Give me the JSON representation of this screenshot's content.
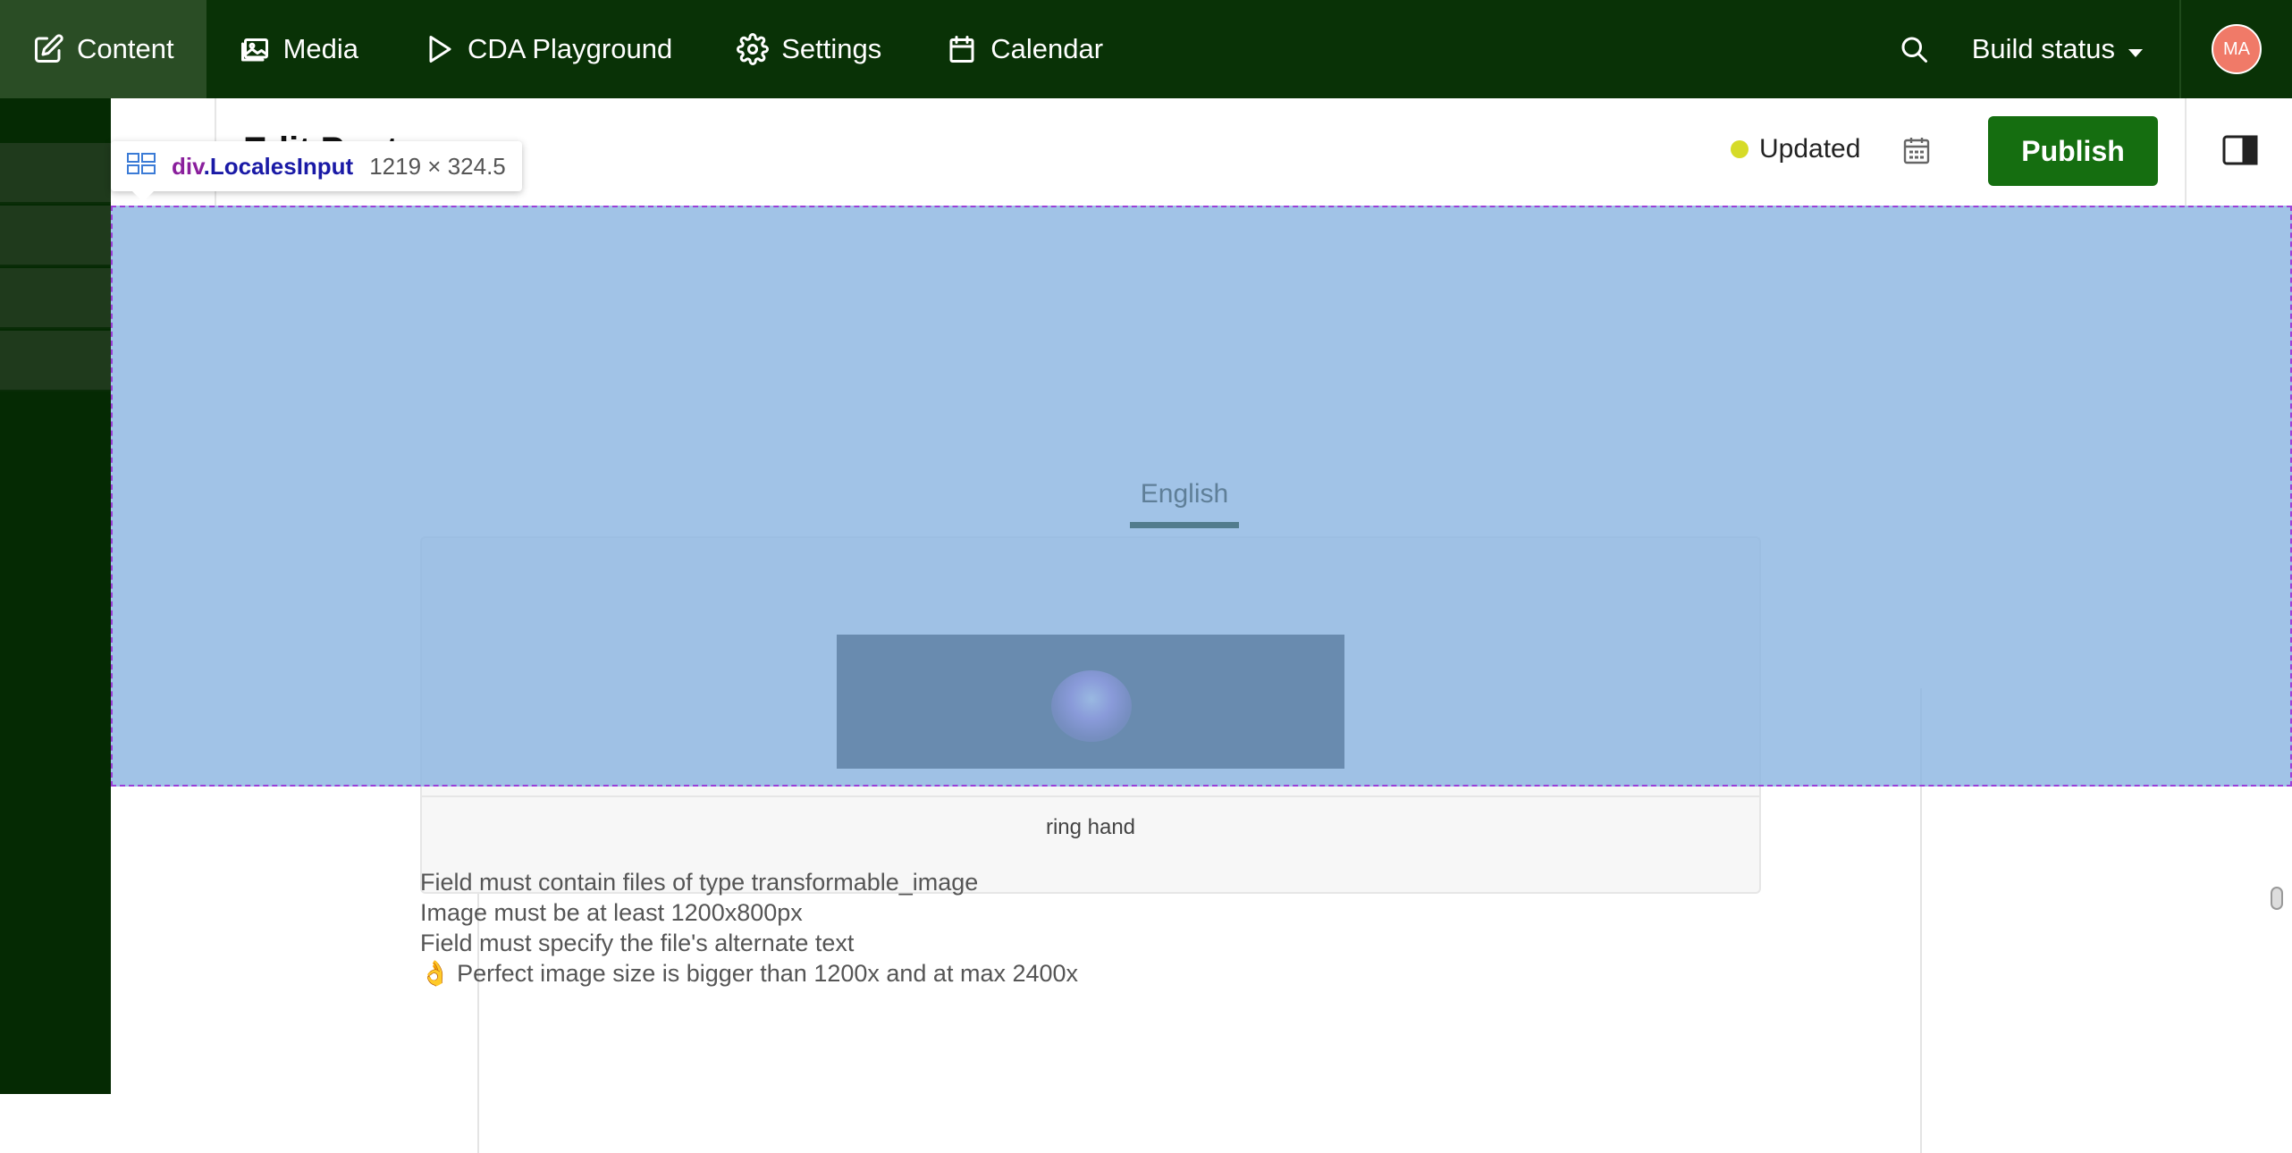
{
  "nav": {
    "items": [
      {
        "label": "Content",
        "icon": "edit-icon"
      },
      {
        "label": "Media",
        "icon": "media-icon"
      },
      {
        "label": "CDA Playground",
        "icon": "play-icon"
      },
      {
        "label": "Settings",
        "icon": "gear-icon"
      },
      {
        "label": "Calendar",
        "icon": "calendar-icon"
      }
    ],
    "build_status_label": "Build status",
    "avatar_initials": "MA"
  },
  "editor": {
    "back_glyph": "<",
    "title": "Edit Post",
    "status_label": "Updated",
    "publish_label": "Publish"
  },
  "inspector": {
    "selector_tag": "div",
    "selector_class": ".LocalesInput",
    "size": "1219 × 324.5"
  },
  "locales": {
    "active_tab": "English"
  },
  "image_field": {
    "caption": "ring hand",
    "validations": [
      "Field must contain files of type transformable_image",
      "Image must be at least 1200x800px",
      "Field must specify the file's alternate text",
      "👌 Perfect image size is bigger than 1200x and at max 2400x"
    ]
  },
  "colors": {
    "topbar": "#093206",
    "sidebar": "#052a03",
    "publish": "#156e10",
    "status_dot": "#d6db28",
    "overlay": "#86b2e0"
  }
}
